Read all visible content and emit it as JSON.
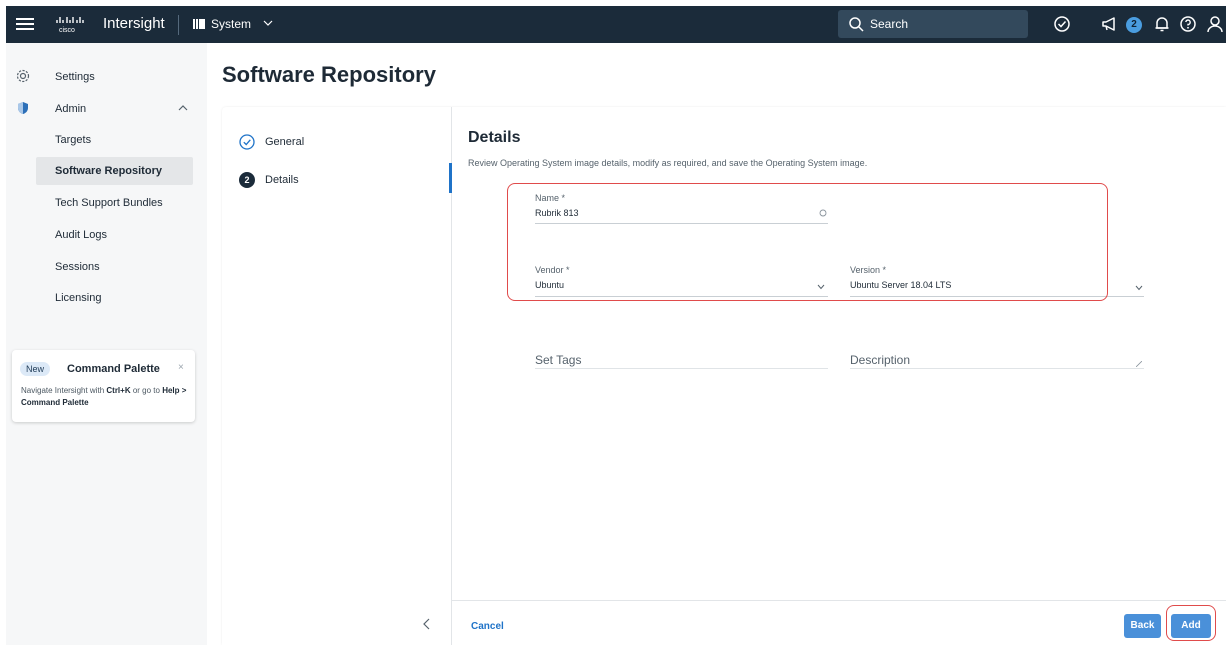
{
  "topbar": {
    "app_title": "Intersight",
    "context_label": "System",
    "search_label": "Search",
    "announcements_count": "2"
  },
  "sidebar": {
    "settings_label": "Settings",
    "admin_label": "Admin",
    "items": [
      {
        "label": "Targets"
      },
      {
        "label": "Software Repository"
      },
      {
        "label": "Tech Support Bundles"
      },
      {
        "label": "Audit Logs"
      },
      {
        "label": "Sessions"
      },
      {
        "label": "Licensing"
      }
    ],
    "command_card": {
      "badge": "New",
      "title": "Command Palette",
      "close": "×",
      "text_1": "Navigate Intersight with ",
      "shortcut": "Ctrl+K",
      "text_2": " or go to ",
      "path": "Help > Command Palette"
    }
  },
  "page": {
    "title": "Software Repository"
  },
  "wizard": {
    "steps": [
      {
        "label": "General",
        "state": "complete"
      },
      {
        "number": "2",
        "label": "Details",
        "state": "active"
      }
    ],
    "details_title": "Details",
    "details_desc": "Review Operating System image details, modify as required, and save the Operating System image.",
    "fields": {
      "name_label": "Name *",
      "name_value": "Rubrik 813",
      "vendor_label": "Vendor *",
      "vendor_value": "Ubuntu",
      "version_label": "Version *",
      "version_value": "Ubuntu Server 18.04 LTS",
      "tags_placeholder": "Set Tags",
      "description_placeholder": "Description"
    },
    "footer": {
      "cancel": "Cancel",
      "back": "Back",
      "add": "Add"
    }
  },
  "colors": {
    "topbar_bg": "#1b2b3a",
    "accent": "#1f73c8",
    "button": "#4a90d9",
    "highlight": "#e04b4b"
  }
}
